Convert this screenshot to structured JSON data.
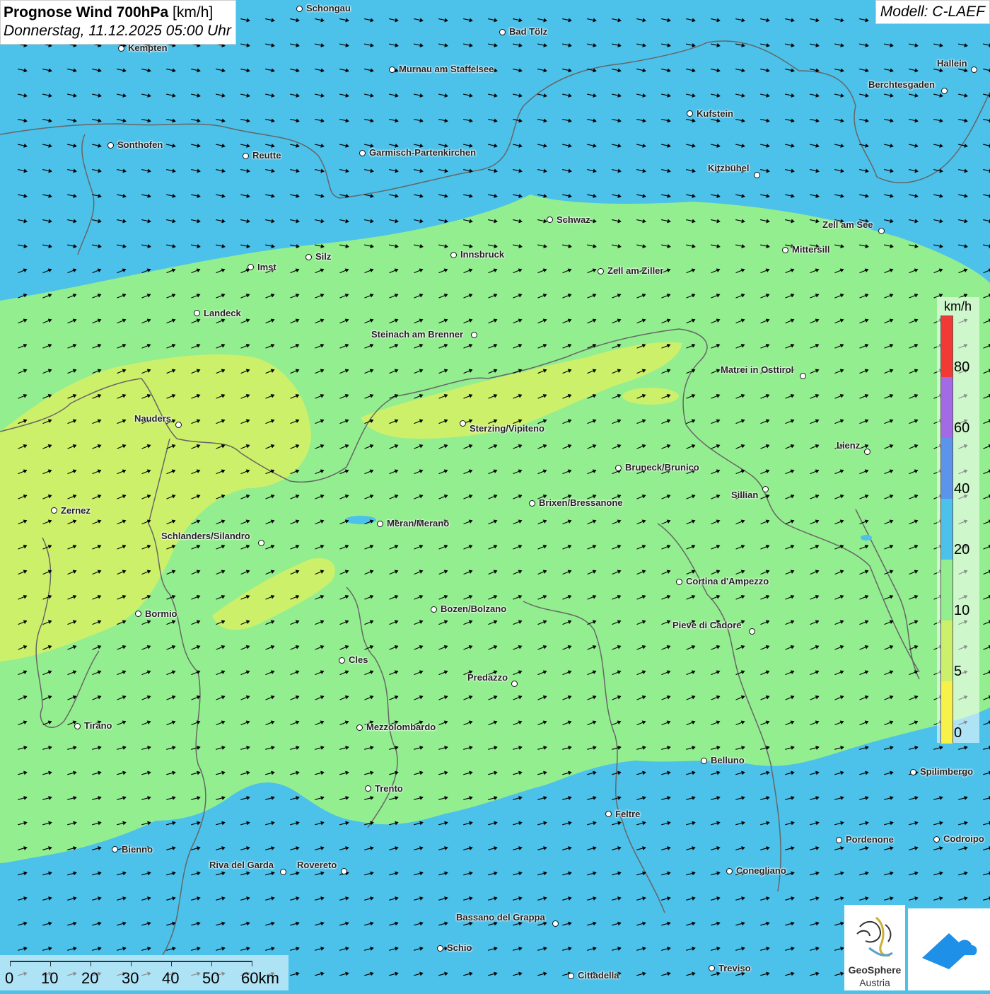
{
  "header": {
    "title_bold": "Prognose Wind 700hPa",
    "title_unit": "[km/h]",
    "datetime": "Donnerstag, 11.12.2025 05:00 Uhr",
    "model": "Modell: C-LAEF"
  },
  "colors": {
    "band_0_5": "#f7f24a",
    "band_5_10": "#cdf06a",
    "band_10_20": "#93ee8f",
    "band_20_40": "#4cc1ea",
    "band_40_60": "#5b94ea",
    "band_60_80": "#a36ae6",
    "band_80_plus": "#f23a35",
    "borders": "#666666",
    "arrows": "#000000"
  },
  "legend": {
    "unit": "km/h",
    "ticks": [
      "80",
      "60",
      "40",
      "20",
      "10",
      "5",
      "0"
    ]
  },
  "scale_bar": {
    "labels": [
      "0",
      "10",
      "20",
      "30",
      "40",
      "50",
      "60km"
    ]
  },
  "cities": [
    {
      "name": "Schongau"
    },
    {
      "name": "Bad Tölz"
    },
    {
      "name": "Kempten"
    },
    {
      "name": "Murnau am Staffelsee"
    },
    {
      "name": "Hallein"
    },
    {
      "name": "Berchtesgaden"
    },
    {
      "name": "Kufstein"
    },
    {
      "name": "Sonthofen"
    },
    {
      "name": "Reutte"
    },
    {
      "name": "Garmisch-Partenkirchen"
    },
    {
      "name": "Kitzbühel"
    },
    {
      "name": "Schwaz"
    },
    {
      "name": "Zell am See"
    },
    {
      "name": "Mittersill"
    },
    {
      "name": "Silz"
    },
    {
      "name": "Innsbruck"
    },
    {
      "name": "Imst"
    },
    {
      "name": "Zell am Ziller"
    },
    {
      "name": "Landeck"
    },
    {
      "name": "Steinach am Brenner"
    },
    {
      "name": "Matrei in Osttirol"
    },
    {
      "name": "Nauders"
    },
    {
      "name": "Sterzing/Vipiteno"
    },
    {
      "name": "Lienz"
    },
    {
      "name": "Bruneck/Brunico"
    },
    {
      "name": "Sillian"
    },
    {
      "name": "Brixen/Bressanone"
    },
    {
      "name": "Zernez"
    },
    {
      "name": "Meran/Merano"
    },
    {
      "name": "Schlanders/Silandro"
    },
    {
      "name": "Cortina d'Ampezzo"
    },
    {
      "name": "Bozen/Bolzano"
    },
    {
      "name": "Bormio"
    },
    {
      "name": "Pieve di Cadore"
    },
    {
      "name": "Cles"
    },
    {
      "name": "Predazzo"
    },
    {
      "name": "Tirano"
    },
    {
      "name": "Mezzolombardo"
    },
    {
      "name": "Belluno"
    },
    {
      "name": "Spilimbergo"
    },
    {
      "name": "Trento"
    },
    {
      "name": "Feltre"
    },
    {
      "name": "Pordenone"
    },
    {
      "name": "Codroipo"
    },
    {
      "name": "Bienno"
    },
    {
      "name": "Riva del Garda"
    },
    {
      "name": "Rovereto"
    },
    {
      "name": "Conegliano"
    },
    {
      "name": "Bassano del Grappa"
    },
    {
      "name": "Schio"
    },
    {
      "name": "Treviso"
    },
    {
      "name": "Cittadella"
    }
  ],
  "logos": {
    "geosphere_line1": "GeoSphere",
    "geosphere_line2": "Austria"
  }
}
